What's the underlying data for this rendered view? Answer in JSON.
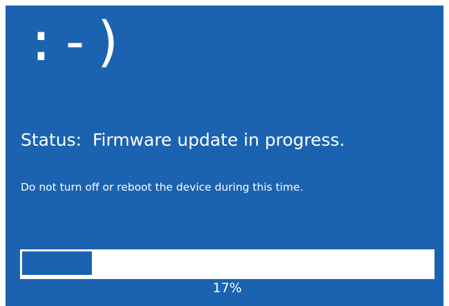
{
  "screen": {
    "emoticon": ":-)",
    "status_text": "Status:  Firmware update in progress.",
    "warning_text": "Do not turn off or reboot the device during this time.",
    "progress": {
      "value": 0.17,
      "label": "17%"
    },
    "colors": {
      "background": "#1b63b1",
      "foreground": "#ffffff",
      "progress_track": "#ffffff",
      "progress_fill": "#1b63b1"
    }
  }
}
